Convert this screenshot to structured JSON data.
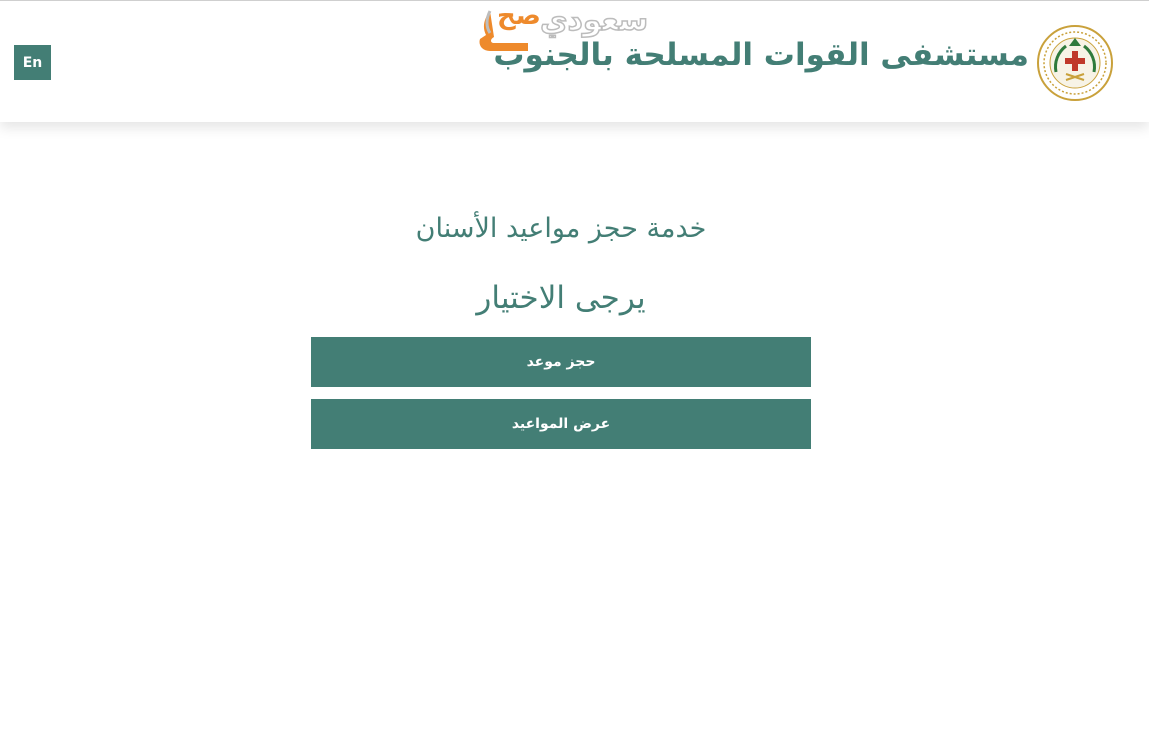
{
  "header": {
    "language_button": "En",
    "hospital_name": "مستشفى القوات المسلحة بالجنوب",
    "watermark_main": "سعودي",
    "watermark_sub": "صح"
  },
  "main": {
    "service_title": "خدمة حجز مواعيد الأسنان",
    "choose_prompt": "يرجى الاختيار",
    "book_button": "حجز موعد",
    "view_button": "عرض المواعيد"
  },
  "colors": {
    "primary": "#437e75",
    "watermark_accent": "#ee8a2c",
    "logo_gold": "#c9a13b",
    "logo_green": "#2f7a3c",
    "logo_red": "#c0392b"
  },
  "icons": {
    "logo": "hospital-emblem-icon",
    "watermark": "watermark-logo-icon"
  }
}
